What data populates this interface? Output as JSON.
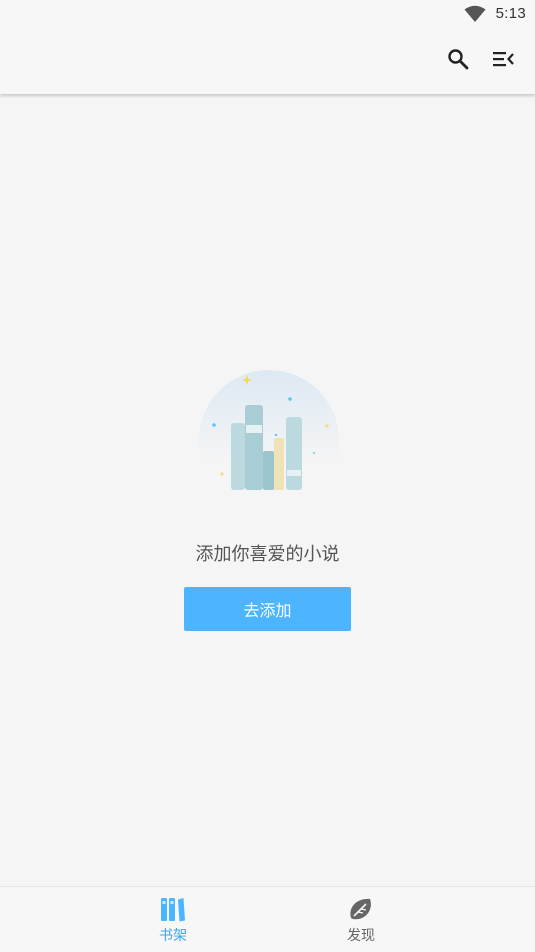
{
  "status_bar": {
    "time": "5:13",
    "wifi_icon": "wifi-icon"
  },
  "app_bar": {
    "actions": [
      {
        "name": "search",
        "icon": "search-icon"
      },
      {
        "name": "menu",
        "icon": "menu-collapse-icon"
      }
    ]
  },
  "empty_state": {
    "illustration": "bookshelf-illustration",
    "message": "添加你喜爱的小说",
    "button_label": "去添加"
  },
  "bottom_nav": {
    "items": [
      {
        "label": "书架",
        "icon": "bookshelf-icon",
        "active": true
      },
      {
        "label": "发现",
        "icon": "discover-icon",
        "active": false
      }
    ]
  },
  "colors": {
    "accent": "#4db5ff",
    "active_nav": "#3aa6ec",
    "background": "#f5f5f5"
  }
}
